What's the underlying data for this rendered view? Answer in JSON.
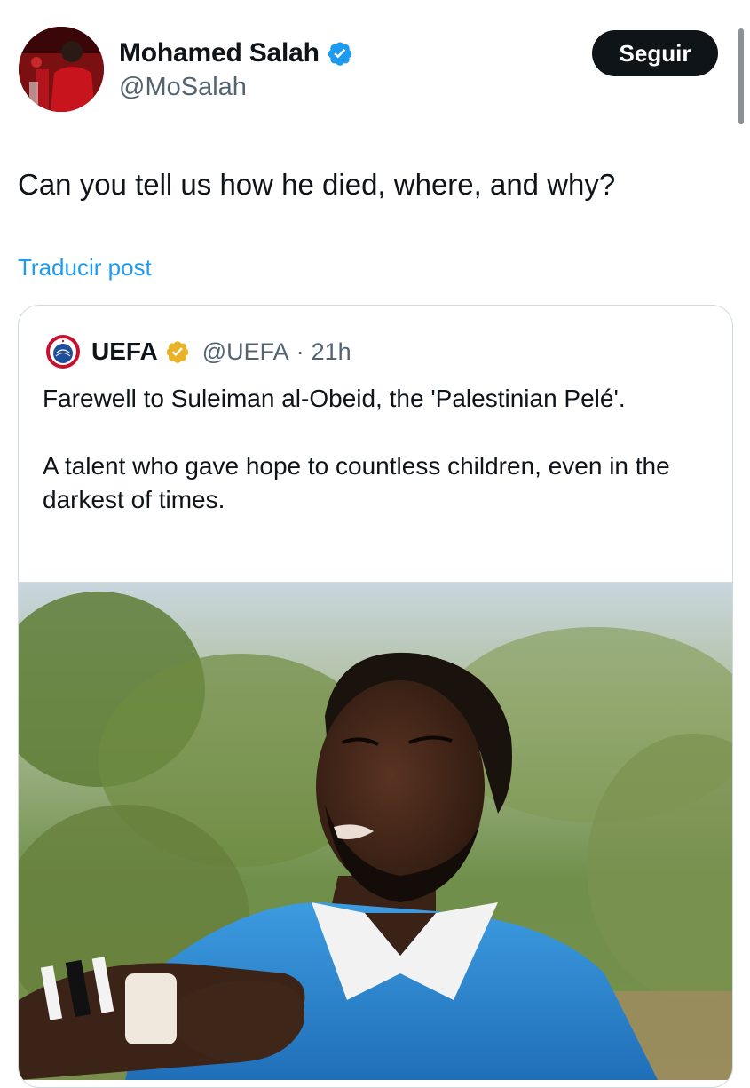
{
  "author": {
    "name": "Mohamed Salah",
    "handle": "@MoSalah",
    "verified_icon": "verified-blue-badge",
    "follow_label": "Seguir"
  },
  "tweet": {
    "text": "Can you tell us how he died, where, and why?",
    "translate_label": "Traducir post"
  },
  "quoted": {
    "name": "UEFA",
    "handle": "@UEFA",
    "separator": "·",
    "time": "21h",
    "verified_icon": "verified-gold-badge",
    "paragraphs": [
      "Farewell to Suleiman al-Obeid, the 'Palestinian Pelé'.",
      "A talent who gave hope to countless children, even in the darkest of times."
    ]
  },
  "colors": {
    "link": "#1d9bf0",
    "secondary_text": "#536471",
    "follow_button_bg": "#0f1419",
    "verified_blue": "#1d9bf0",
    "verified_gold": "#e8b229"
  }
}
